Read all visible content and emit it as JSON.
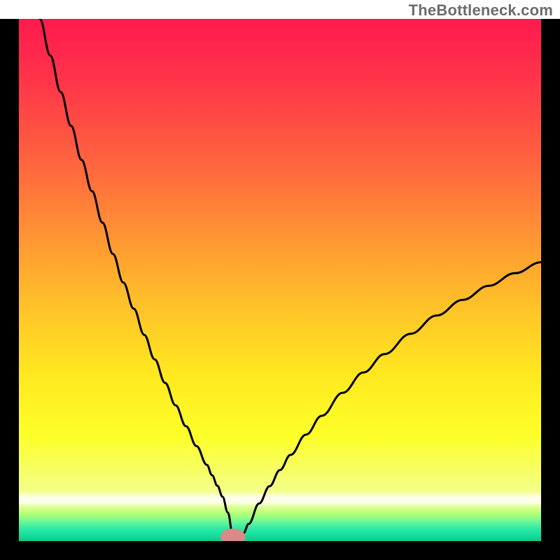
{
  "watermark": "TheBottleneck.com",
  "chart_data": {
    "type": "line",
    "title": "",
    "xlabel": "",
    "ylabel": "",
    "xlim": [
      0,
      100
    ],
    "ylim": [
      0,
      100
    ],
    "grid": false,
    "legend": false,
    "annotations": [],
    "x_min_point": 41,
    "marker": {
      "x": 41,
      "y": 0.8,
      "color": "#d88a86",
      "rx": 2.4,
      "ry": 1.6
    },
    "series": [
      {
        "name": "curve",
        "x": [
          4,
          6,
          8,
          10,
          12,
          14,
          16,
          18,
          20,
          22,
          24,
          26,
          28,
          30,
          32,
          34,
          36,
          37,
          38,
          39,
          40,
          41,
          42,
          43,
          44,
          46,
          48,
          50,
          52,
          55,
          58,
          62,
          66,
          70,
          75,
          80,
          85,
          90,
          95,
          100
        ],
        "y": [
          100,
          93,
          86,
          79.5,
          73,
          67,
          61,
          55,
          49.5,
          44.5,
          39.5,
          34.8,
          30.3,
          26,
          22,
          18.2,
          14.6,
          12.6,
          10.6,
          8.5,
          5.5,
          0.9,
          0.9,
          1.5,
          3.3,
          7.2,
          10.5,
          13.6,
          16.5,
          20.4,
          24,
          28.4,
          32.3,
          35.8,
          39.7,
          43.2,
          46.2,
          48.9,
          51.3,
          53.4
        ]
      }
    ],
    "background_gradient": {
      "type": "vertical",
      "stops": [
        {
          "pos": 0.0,
          "color": "#ff1a4e"
        },
        {
          "pos": 0.12,
          "color": "#ff3549"
        },
        {
          "pos": 0.28,
          "color": "#ff663e"
        },
        {
          "pos": 0.42,
          "color": "#ff9633"
        },
        {
          "pos": 0.55,
          "color": "#ffc229"
        },
        {
          "pos": 0.68,
          "color": "#ffe820"
        },
        {
          "pos": 0.8,
          "color": "#fdff29"
        },
        {
          "pos": 0.905,
          "color": "#f3ff8a"
        },
        {
          "pos": 0.915,
          "color": "#feffe8"
        },
        {
          "pos": 0.926,
          "color": "#feffe8"
        },
        {
          "pos": 0.934,
          "color": "#dfff9a"
        },
        {
          "pos": 0.944,
          "color": "#c2ff77"
        },
        {
          "pos": 0.954,
          "color": "#95ff81"
        },
        {
          "pos": 0.964,
          "color": "#66f59a"
        },
        {
          "pos": 0.975,
          "color": "#33e9a4"
        },
        {
          "pos": 0.987,
          "color": "#16e0a2"
        },
        {
          "pos": 1.0,
          "color": "#0fca84"
        }
      ]
    }
  }
}
